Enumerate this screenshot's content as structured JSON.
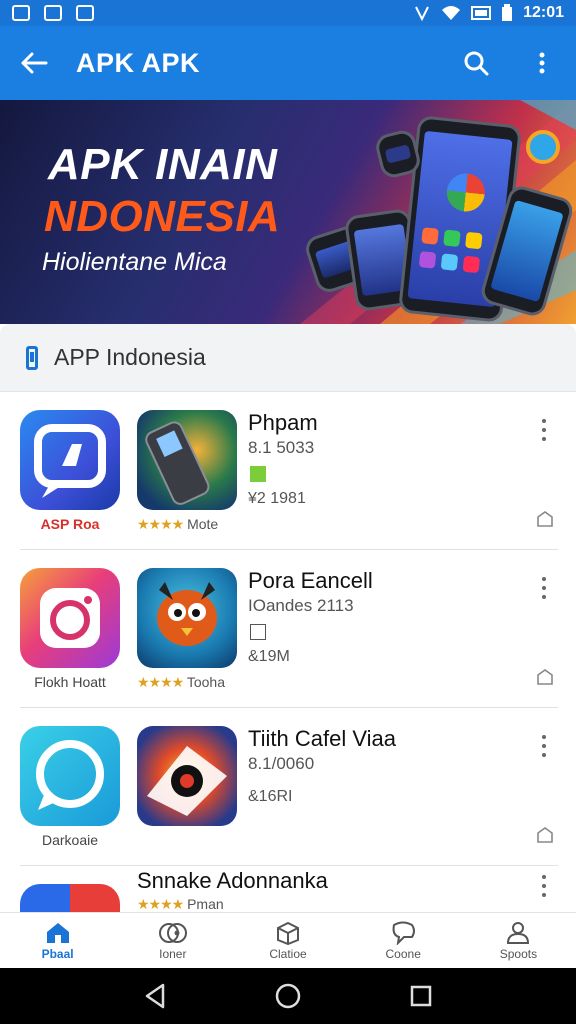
{
  "status_bar": {
    "time": "12:01",
    "battery": ""
  },
  "app_bar": {
    "title": "APK APK"
  },
  "banner": {
    "title_line1": "APK INAIN",
    "title_line2": "NDONESIA",
    "subtitle": "Hiolientane Mica"
  },
  "section": {
    "label": "APP Indonesia"
  },
  "apps": [
    {
      "name": "Phpam",
      "meta": "8.1 5033",
      "size": "¥2 1981",
      "caption_left": "ASP Roa",
      "caption_right": "Mote",
      "stars": "★★★★"
    },
    {
      "name": "Pora Eancell",
      "meta": "IOandes 2113",
      "size": "&19M",
      "caption_left": "Flokh Hoatt",
      "caption_right": "Tooha",
      "stars": "★★★★"
    },
    {
      "name": "Tiith Cafel Viaa",
      "meta": "8.1/0060",
      "size": "&16RI",
      "caption_left": "Darkoaie",
      "caption_right": "",
      "stars": ""
    },
    {
      "name": "Snnake Adonnanka",
      "meta": "",
      "size": "",
      "caption_left": "",
      "caption_right": "Pman",
      "stars": "★★★★"
    }
  ],
  "bottom_nav": [
    {
      "label": "Pbaal",
      "icon": "home-icon",
      "active": true
    },
    {
      "label": "Ioner",
      "icon": "cd-icon",
      "active": false
    },
    {
      "label": "Clatioe",
      "icon": "box-icon",
      "active": false
    },
    {
      "label": "Coone",
      "icon": "chat-icon",
      "active": false
    },
    {
      "label": "Spoots",
      "icon": "person-icon",
      "active": false
    }
  ],
  "colors": {
    "primary": "#1a7fe0",
    "status": "#1a74d6",
    "accent_orange": "#ff5a1a"
  }
}
